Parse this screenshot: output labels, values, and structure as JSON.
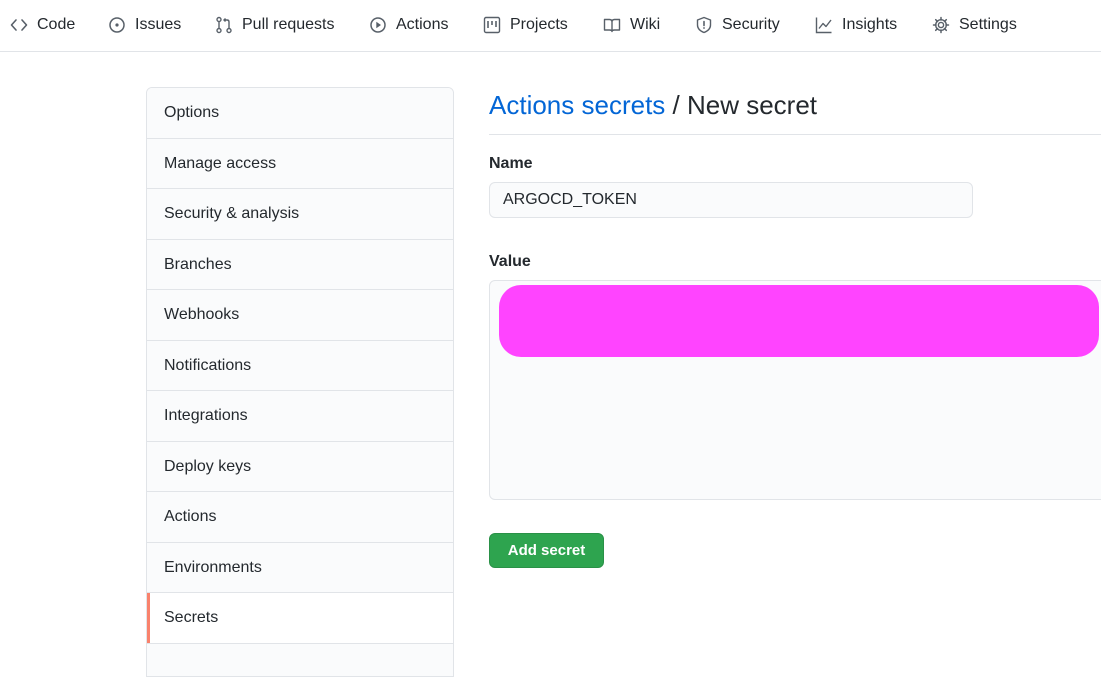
{
  "repo_nav": {
    "items": [
      {
        "label": "Code",
        "icon": "code-icon"
      },
      {
        "label": "Issues",
        "icon": "issue-opened-icon"
      },
      {
        "label": "Pull requests",
        "icon": "git-pull-request-icon"
      },
      {
        "label": "Actions",
        "icon": "play-icon"
      },
      {
        "label": "Projects",
        "icon": "project-icon"
      },
      {
        "label": "Wiki",
        "icon": "book-icon"
      },
      {
        "label": "Security",
        "icon": "shield-icon"
      },
      {
        "label": "Insights",
        "icon": "graph-icon"
      },
      {
        "label": "Settings",
        "icon": "gear-icon"
      }
    ]
  },
  "sidebar": {
    "items": [
      {
        "label": "Options"
      },
      {
        "label": "Manage access"
      },
      {
        "label": "Security & analysis"
      },
      {
        "label": "Branches"
      },
      {
        "label": "Webhooks"
      },
      {
        "label": "Notifications"
      },
      {
        "label": "Integrations"
      },
      {
        "label": "Deploy keys"
      },
      {
        "label": "Actions"
      },
      {
        "label": "Environments"
      },
      {
        "label": "Secrets",
        "selected": true
      }
    ]
  },
  "main": {
    "breadcrumb_link": "Actions secrets",
    "separator": " / ",
    "page_title": "New secret",
    "name_label": "Name",
    "name_value": "ARGOCD_TOKEN",
    "value_label": "Value",
    "submit_label": "Add secret"
  },
  "colors": {
    "link": "#0366d6",
    "primary_button": "#2ea44f",
    "selected_marker": "#f9826c",
    "redaction": "#ff44ff"
  }
}
